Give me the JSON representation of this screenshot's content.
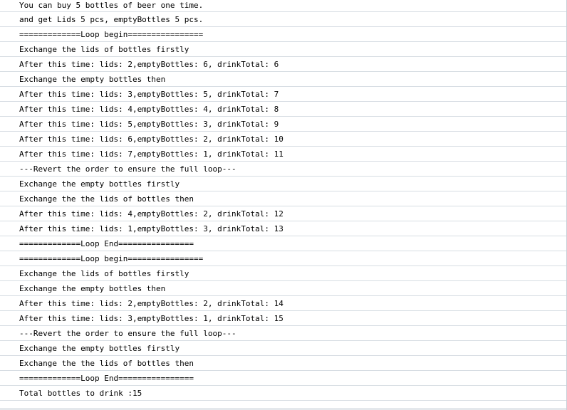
{
  "console": {
    "lines": [
      "You can buy 5 bottles of beer one time.",
      "and get Lids 5 pcs, emptyBottles 5 pcs.",
      "=============Loop begin================",
      "Exchange the lids of bottles firstly",
      "After this time: lids: 2,emptyBottles: 6, drinkTotal: 6",
      "Exchange the empty bottles then",
      "After this time: lids: 3,emptyBottles: 5, drinkTotal: 7",
      "After this time: lids: 4,emptyBottles: 4, drinkTotal: 8",
      "After this time: lids: 5,emptyBottles: 3, drinkTotal: 9",
      "After this time: lids: 6,emptyBottles: 2, drinkTotal: 10",
      "After this time: lids: 7,emptyBottles: 1, drinkTotal: 11",
      "---Revert the order to ensure the full loop---",
      "Exchange the empty bottles firstly",
      "Exchange the the lids of bottles then",
      "After this time: lids: 4,emptyBottles: 2, drinkTotal: 12",
      "After this time: lids: 1,emptyBottles: 3, drinkTotal: 13",
      "=============Loop End================",
      "=============Loop begin================",
      "Exchange the lids of bottles firstly",
      "Exchange the empty bottles then",
      "After this time: lids: 2,emptyBottles: 2, drinkTotal: 14",
      "After this time: lids: 3,emptyBottles: 1, drinkTotal: 15",
      "---Revert the order to ensure the full loop---",
      "Exchange the empty bottles firstly",
      "Exchange the the lids of bottles then",
      "=============Loop End================",
      "Total bottles to drink :15"
    ]
  }
}
